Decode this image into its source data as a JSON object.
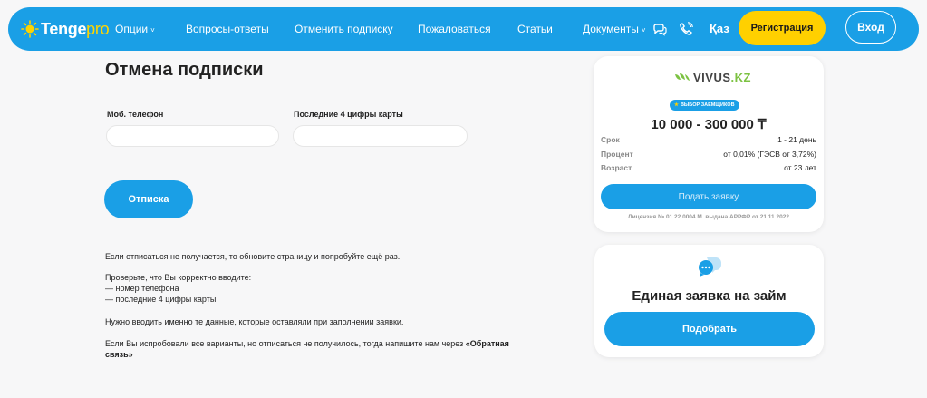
{
  "header": {
    "logo_main": "Tenge",
    "logo_accent": "pro",
    "nav": [
      {
        "label": "Опции",
        "caret": "˅"
      },
      {
        "label": "Вопросы-ответы",
        "caret": ""
      },
      {
        "label": "Отменить подписку",
        "caret": ""
      },
      {
        "label": "Пожаловаться",
        "caret": ""
      },
      {
        "label": "Статьи",
        "caret": ""
      },
      {
        "label": "Документы",
        "caret": "˅"
      }
    ],
    "lang": "Қаз",
    "register_label": "Регистрация",
    "login_label": "Вход"
  },
  "main": {
    "title": "Отмена подписки",
    "phone_label": "Моб. телефон",
    "phone_value": "",
    "card_label": "Последние 4 цифры карты",
    "card_value": "",
    "unsubscribe_label": "Отписка",
    "help": {
      "p1": "Если отписаться не получается, то обновите страницу и попробуйте ещё раз.",
      "p2_intro": "Проверьте, что Вы корректно вводите:",
      "p2_item1": "— номер телефона",
      "p2_item2": "— последние 4 цифры карты",
      "p3": "Нужно вводить именно те данные, которые оставляли при заполнении заявки.",
      "p4_text": "Если Вы испробовали все варианты, но отписаться не получилось, тогда напишите нам через ",
      "p4_link_line1": "«Обратная",
      "p4_link_line2": "связь»"
    }
  },
  "offer": {
    "brand": "VIVUS",
    "brand_suffix": ".KZ",
    "badge": "ВЫБОР ЗАЕМЩИКОВ",
    "amount": "10 000 - 300 000 ₸",
    "rows": [
      {
        "label": "Срок",
        "value": "1 - 21 день"
      },
      {
        "label": "Процент",
        "value": "от 0,01% (ГЭСВ от 3,72%)"
      },
      {
        "label": "Возраст",
        "value": "от 23 лет"
      }
    ],
    "apply_label": "Подать заявку",
    "license": "Лицензия № 01.22.0004.M. выдана АРРФР от 21.11.2022"
  },
  "single": {
    "title": "Единая заявка на займ",
    "pick_label": "Подобрать"
  },
  "colors": {
    "primary": "#1a9fe6",
    "accent": "#ffd000",
    "brand_green": "#7cc242"
  }
}
